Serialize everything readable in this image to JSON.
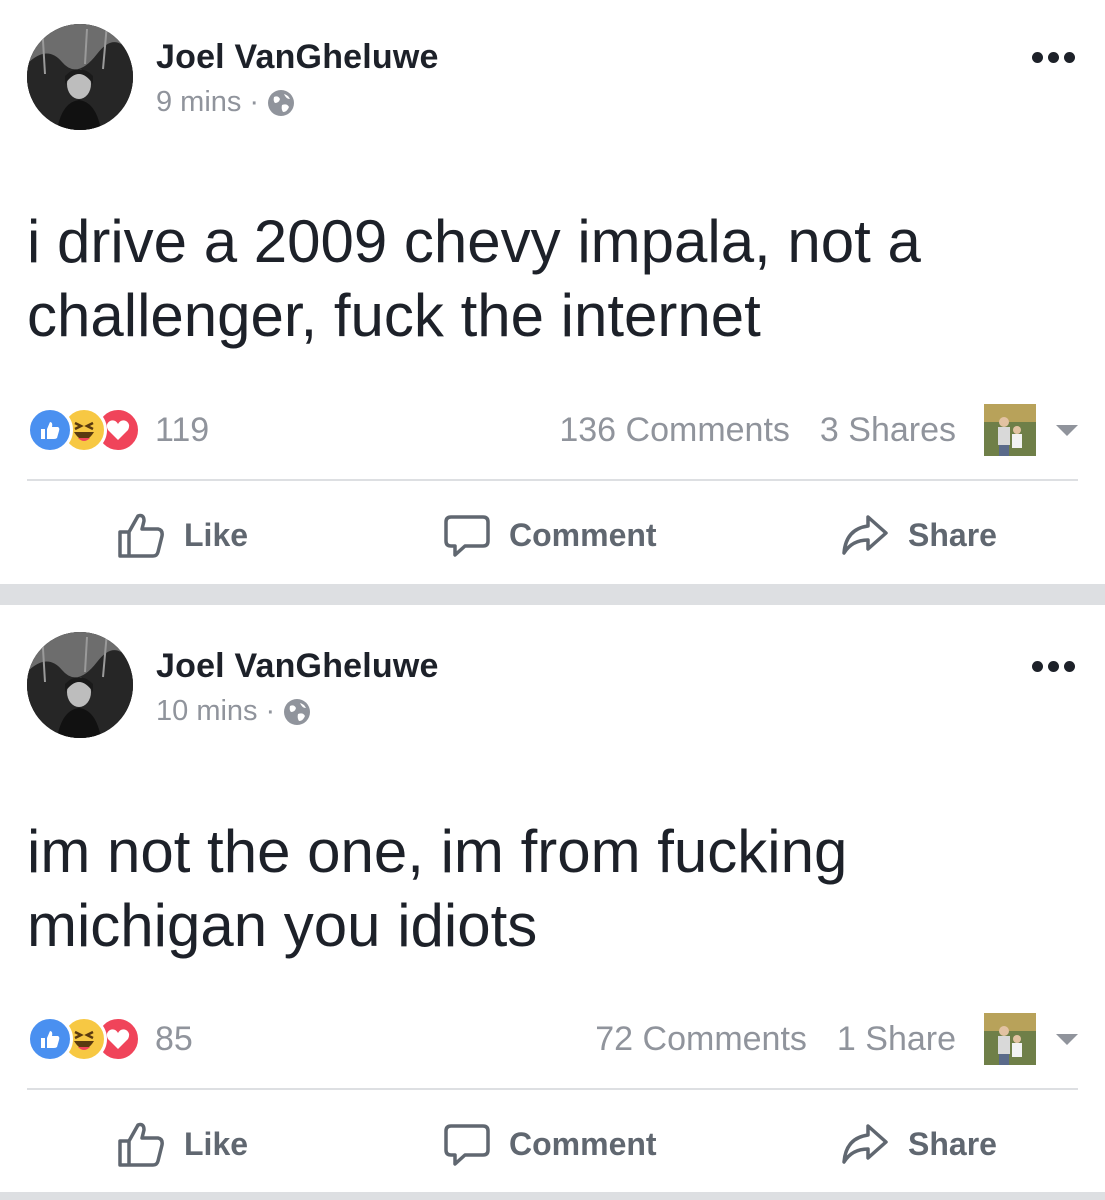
{
  "posts": [
    {
      "author": "Joel VanGheluwe",
      "time": "9 mins",
      "dot": "·",
      "text": "i drive a 2009 chevy impala, not a challenger, fuck the internet",
      "reaction_count": "119",
      "comments": "136 Comments",
      "shares": "3 Shares",
      "actions": {
        "like": "Like",
        "comment": "Comment",
        "share": "Share"
      }
    },
    {
      "author": "Joel VanGheluwe",
      "time": "10 mins",
      "dot": "·",
      "text": "im not the one, im from fucking michigan you idiots",
      "reaction_count": "85",
      "comments": "72 Comments",
      "shares": "1 Share",
      "actions": {
        "like": "Like",
        "comment": "Comment",
        "share": "Share"
      }
    }
  ],
  "icons": [
    "avatar-photo",
    "globe-icon",
    "more-icon",
    "like-reaction-icon",
    "haha-reaction-icon",
    "love-reaction-icon",
    "sharer-avatar",
    "caret-down-icon",
    "thumbs-up-icon",
    "comment-icon",
    "share-arrow-icon"
  ],
  "colors": {
    "text": "#1d2129",
    "meta": "#90949c",
    "separator": "#dddfe2",
    "like_blue": "#4a90f0",
    "haha_yellow": "#f7c843",
    "love_red": "#f0445a"
  }
}
